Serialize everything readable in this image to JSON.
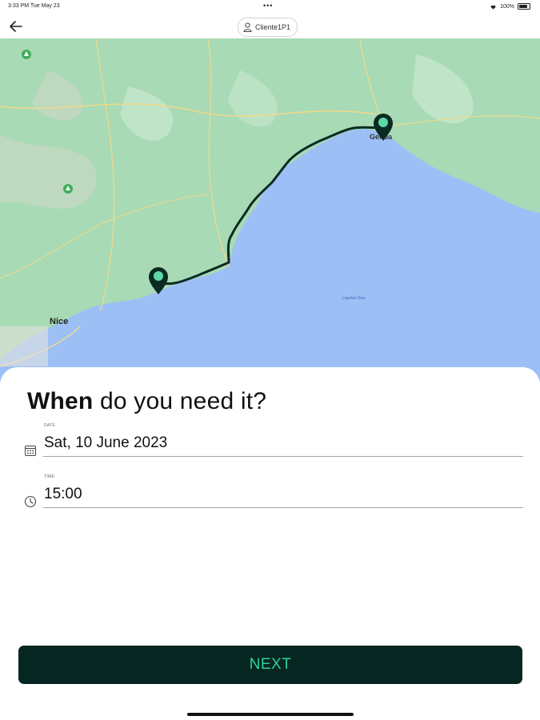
{
  "status_bar": {
    "time": "3:33 PM  Tue May 23",
    "dots": "•••",
    "battery": "100%"
  },
  "header": {
    "user_label": "Cliente1P1"
  },
  "map": {
    "labels": {
      "nice": "Nice",
      "genoa": "Genoa",
      "sea": "Ligurian Sea"
    }
  },
  "form": {
    "heading_bold": "When",
    "heading_rest": " do you need it?",
    "date": {
      "label": "DATE",
      "value": "Sat, 10 June 2023"
    },
    "time": {
      "label": "TIME",
      "value": "15:00"
    }
  },
  "actions": {
    "next_label": "NEXT"
  },
  "colors": {
    "primary_button": "#062622",
    "button_text": "#2fd19a",
    "route": "#0b2b22",
    "sea": "#9cc0f5",
    "land": "#a8dab5"
  }
}
